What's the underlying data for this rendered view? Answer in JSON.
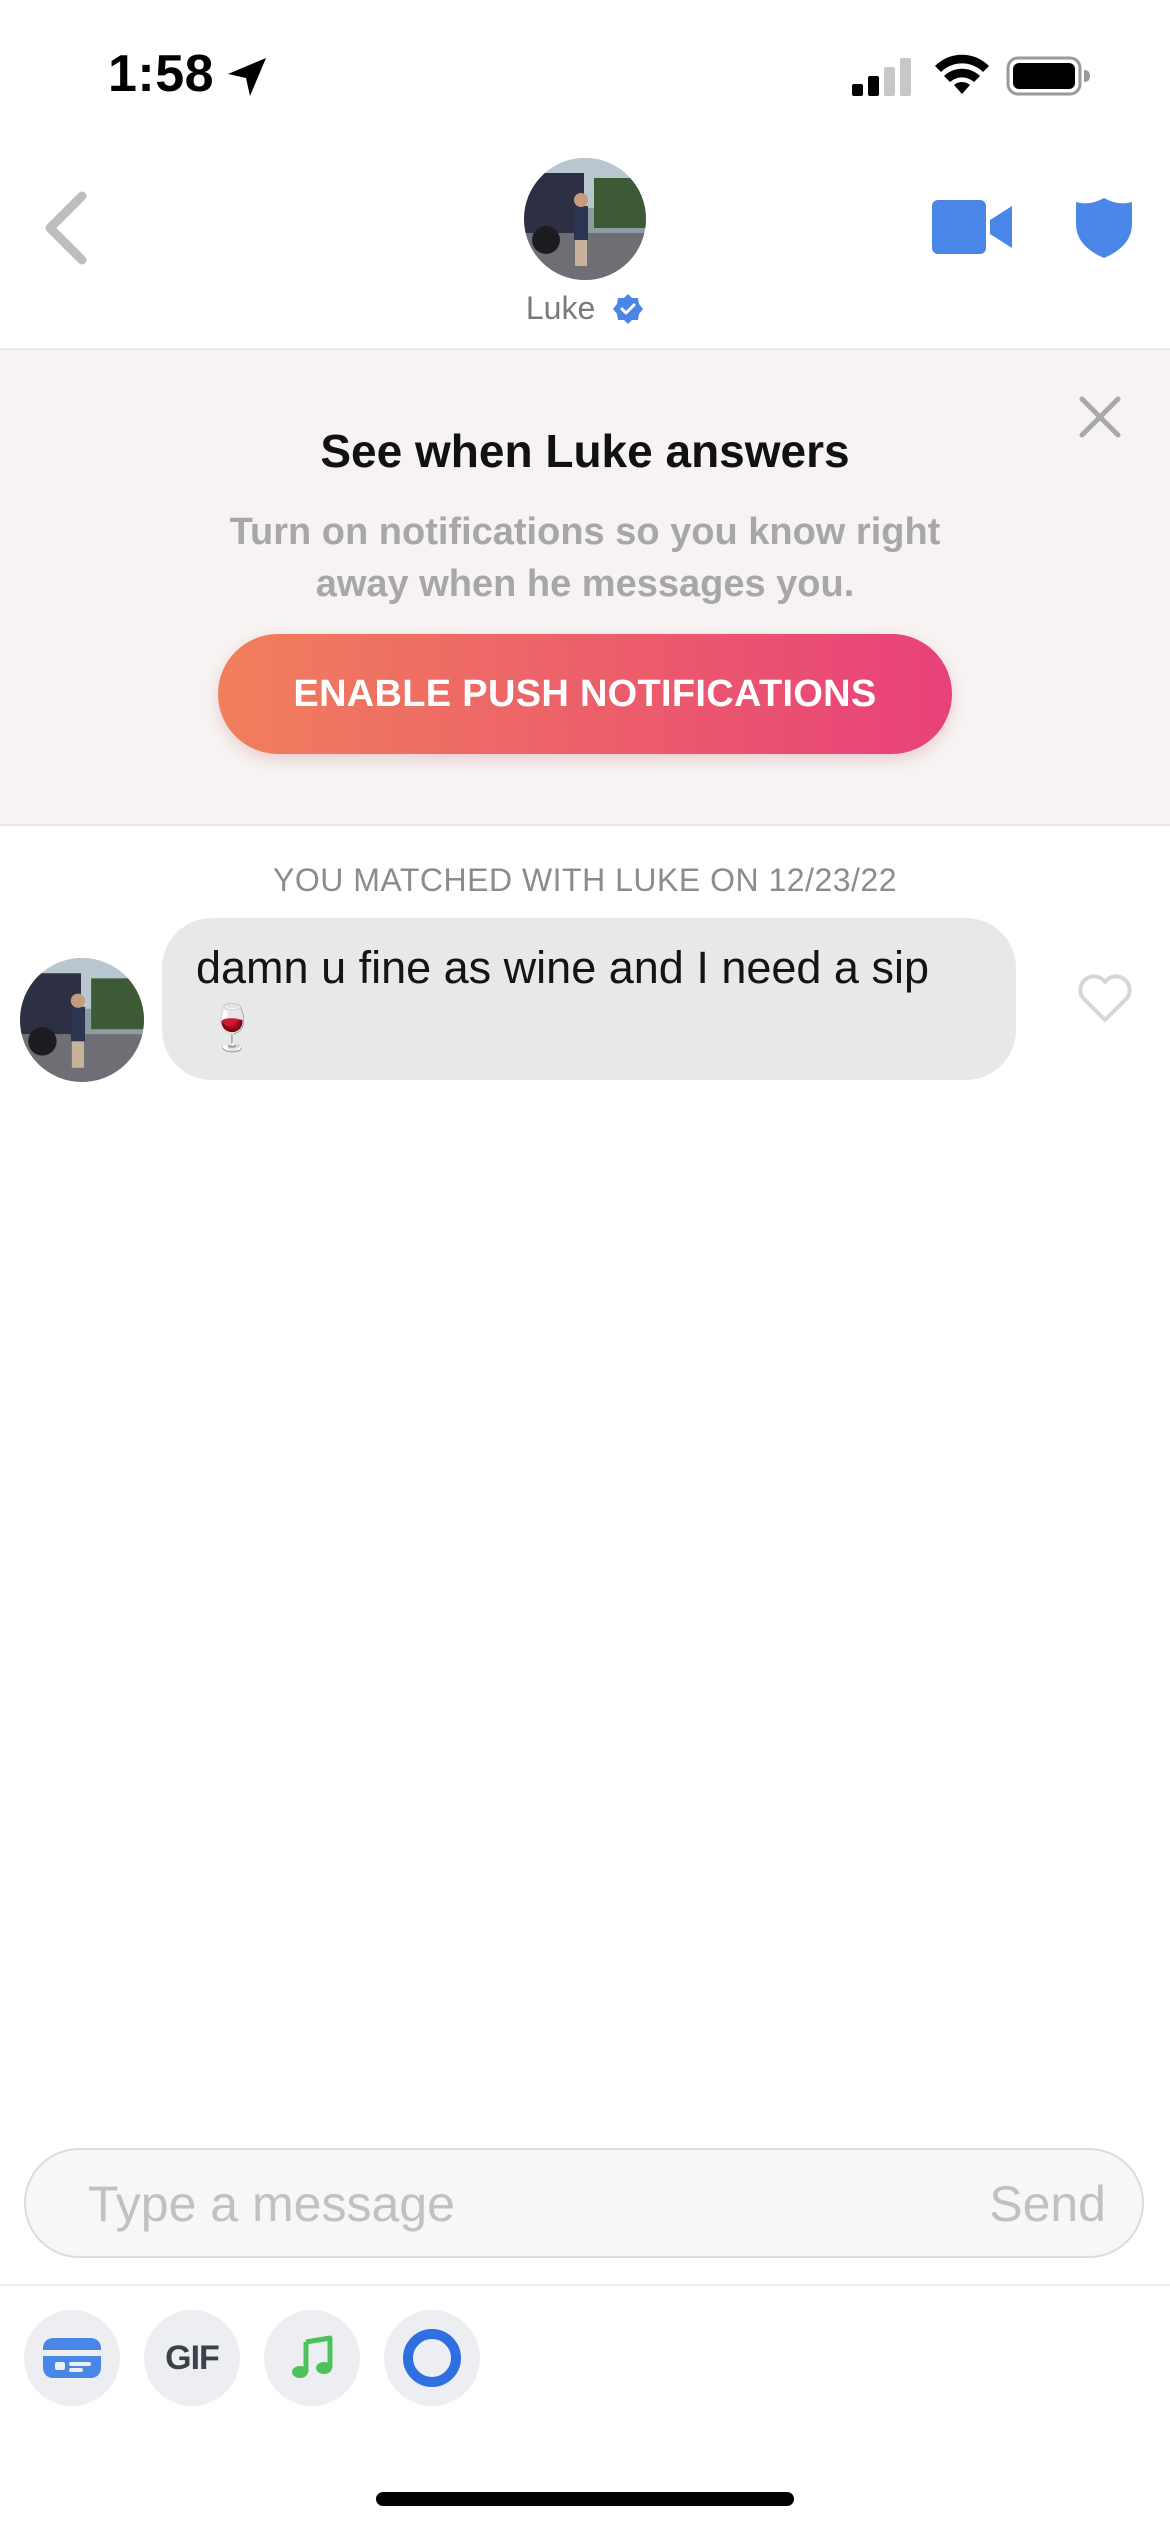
{
  "status_bar": {
    "time": "1:58",
    "icons": [
      "location-arrow-icon",
      "cellular-signal-icon",
      "wifi-icon",
      "battery-icon"
    ]
  },
  "header": {
    "name": "Luke",
    "icons": [
      "chevron-left-icon",
      "verified-badge-icon",
      "video-camera-icon",
      "shield-icon"
    ],
    "accent_color": "#4a86e8"
  },
  "banner": {
    "title": "See when Luke answers",
    "text": "Turn on notifications so you know right away when he messages you.",
    "button_label": "ENABLE PUSH NOTIFICATIONS",
    "gradient": [
      "#f07f5c",
      "#e8417a"
    ]
  },
  "conversation": {
    "match_text": "YOU MATCHED WITH LUKE ON 12/23/22",
    "messages": [
      {
        "text": "damn u fine as wine and I need a sip",
        "emoji": "🍷"
      }
    ]
  },
  "composer": {
    "placeholder": "Type a message",
    "send_label": "Send"
  },
  "toolbar": {
    "items": [
      "sticker-card-icon",
      "GIF",
      "music-note-icon",
      "loop-ring-icon"
    ],
    "gif_label": "GIF"
  }
}
